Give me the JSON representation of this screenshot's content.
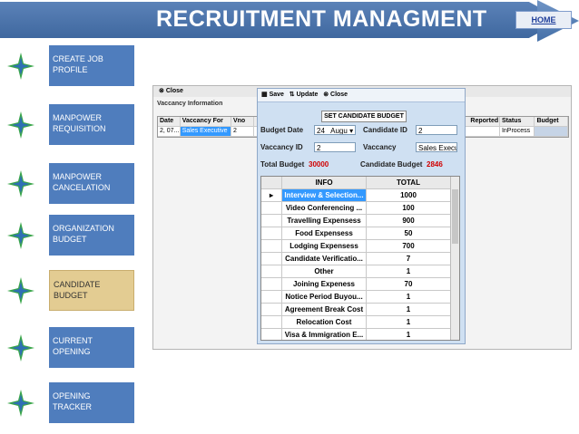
{
  "header": {
    "title": "RECRUITMENT MANAGMENT",
    "home_label": "HOME"
  },
  "nav": [
    {
      "label": "CREATE JOB PROFILE"
    },
    {
      "label": "MANPOWER REQUISITION"
    },
    {
      "label": "MANPOWER CANCELATION"
    },
    {
      "label": "ORGANIZATION BUDGET"
    },
    {
      "label": "CANDIDATE BUDGET",
      "active": true
    },
    {
      "label": "CURRENT OPENING"
    },
    {
      "label": "OPENING TRACKER"
    }
  ],
  "back_window": {
    "close_label": "Close",
    "section_label": "Vaccancy Information",
    "columns": [
      "Date",
      "Vaccancy For",
      "Vno",
      "Reported",
      "Status",
      "Budget"
    ],
    "row": {
      "date": "2, 07...",
      "vaccancy_for": "Sales Executive",
      "vno": "2",
      "status": "InProcess"
    }
  },
  "budget_window": {
    "save_label": "Save",
    "update_label": "Update",
    "close_label": "Close",
    "heading": "SET CANDIDATE BUDGET",
    "budget_date_label": "Budget Date",
    "budget_date_day": "24",
    "budget_date_month": "Augu",
    "candidate_id_label": "Candidate ID",
    "candidate_id_value": "2",
    "vaccancy_id_label": "Vaccancy ID",
    "vaccancy_id_value": "2",
    "vaccancy_label": "Vaccancy",
    "vaccancy_value": "Sales Execu",
    "total_budget_label": "Total Budget",
    "total_budget_value": "30000",
    "candidate_budget_label": "Candidate Budget",
    "candidate_budget_value": "2846",
    "grid_columns": [
      "INFO",
      "TOTAL"
    ],
    "grid_rows": [
      {
        "info": "Interview & Selection...",
        "total": "1000"
      },
      {
        "info": "Video Conferencing ...",
        "total": "100"
      },
      {
        "info": "Travelling Expensess",
        "total": "900"
      },
      {
        "info": "Food Expensess",
        "total": "50"
      },
      {
        "info": "Lodging Expensess",
        "total": "700"
      },
      {
        "info": "Candidate Verificatio...",
        "total": "7"
      },
      {
        "info": "Other",
        "total": "1"
      },
      {
        "info": "Joining Expeness",
        "total": "70"
      },
      {
        "info": "Notice Period Buyou...",
        "total": "1"
      },
      {
        "info": "Agreement Break Cost",
        "total": "1"
      },
      {
        "info": "Relocation Cost",
        "total": "1"
      },
      {
        "info": "Visa & Immigration E...",
        "total": "1"
      }
    ]
  }
}
